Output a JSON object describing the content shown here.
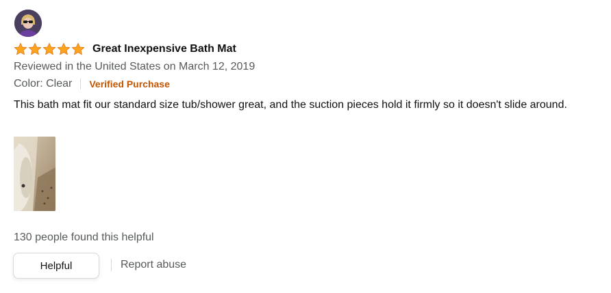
{
  "review": {
    "avatar_icon": "user-avatar",
    "rating": 5,
    "rating_max": 5,
    "star_color": "#ffa41c",
    "title": "Great Inexpensive Bath Mat",
    "meta": "Reviewed in the United States on March 12, 2019",
    "variant": "Color: Clear",
    "verified_label": "Verified Purchase",
    "verified_color": "#c45500",
    "body": "This bath mat fit our standard size tub/shower great, and the suction pieces hold it firmly so it doesn't slide around.",
    "helpful_count_text": "130 people found this helpful",
    "helpful_button_label": "Helpful",
    "report_label": "Report abuse"
  }
}
